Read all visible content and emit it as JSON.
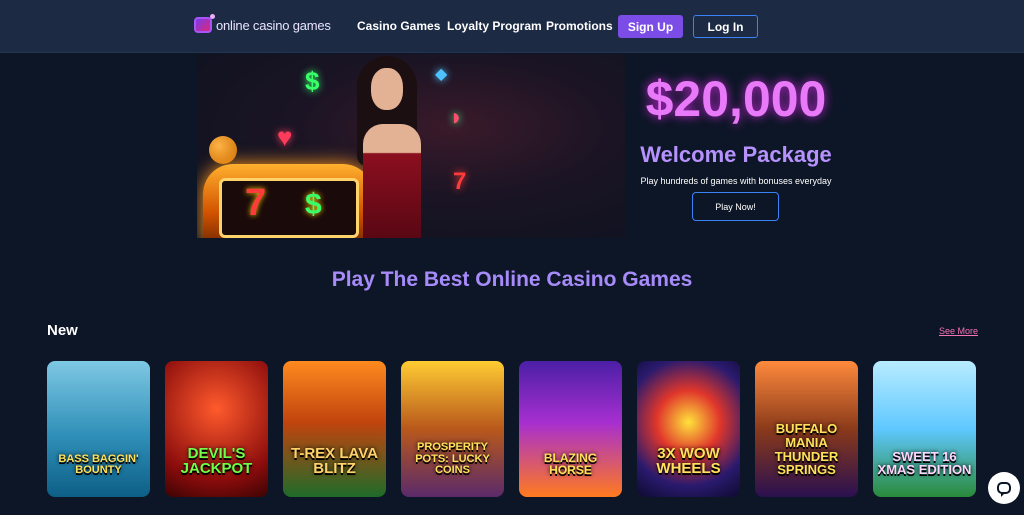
{
  "header": {
    "logo_text": "online casino games",
    "nav": [
      "Casino Games",
      "Loyalty Program",
      "Promotions"
    ],
    "signup_label": "Sign Up",
    "login_label": "Log In"
  },
  "hero": {
    "amount": "$20,000",
    "title": "Welcome Package",
    "subtitle": "Play hundreds of games with bonuses everyday",
    "cta_label": "Play Now!",
    "art_symbols": {
      "dollar": "$",
      "gem": "◆",
      "cherry": "♥",
      "melon": "◗",
      "seven": "7"
    }
  },
  "section": {
    "title": "Play The Best Online Casino Games",
    "new_heading": "New",
    "see_more": "See More"
  },
  "games": [
    {
      "title": "BASS BAGGIN' BOUNTY"
    },
    {
      "title": "DEVIL'S JACKPOT"
    },
    {
      "title": "T-REX LAVA BLITZ"
    },
    {
      "title": "PROSPERITY POTS: LUCKY COINS"
    },
    {
      "title": "BLAZING HORSE"
    },
    {
      "title": "3X WOW WHEELS"
    },
    {
      "title": "BUFFALO MANIA THUNDER SPRINGS"
    },
    {
      "title": "SWEET 16 XMAS EDITION"
    }
  ],
  "colors": {
    "background": "#0d1626",
    "header": "#1c2a44",
    "accent_purple": "#7b4ce6",
    "amount_pink": "#e879f9",
    "see_more_pink": "#f472b6"
  }
}
